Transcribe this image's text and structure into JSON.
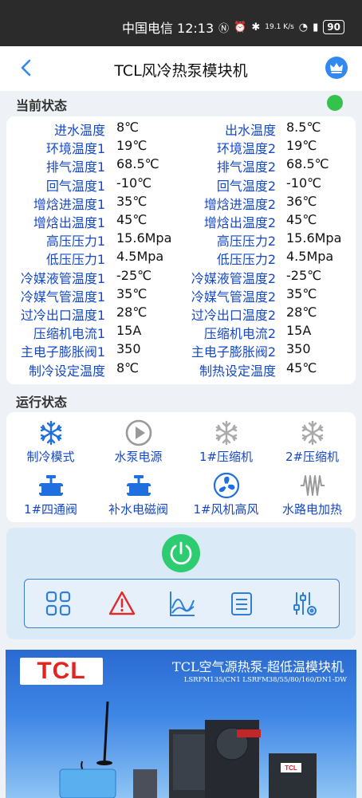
{
  "status_bar": {
    "carrier_time": "中国电信 12:13",
    "net_speed": "19.1 K/s",
    "battery": "90",
    "icons": [
      "nfc-icon",
      "alarm-icon",
      "bluetooth-icon",
      "speed-indicator",
      "signal-icon",
      "wifi-icon",
      "5g-icon",
      "battery-icon"
    ]
  },
  "header": {
    "title": "TCL风冷热泵模块机",
    "back_icon": "back-arrow-icon",
    "vip_icon": "crown-icon"
  },
  "current_status": {
    "title": "当前状态",
    "indicator_color": "#35c24a",
    "rows": [
      {
        "l1": "进水温度",
        "v1": "8℃",
        "l2": "出水温度",
        "v2": "8.5℃"
      },
      {
        "l1": "环境温度1",
        "v1": "19℃",
        "l2": "环境温度2",
        "v2": "19℃"
      },
      {
        "l1": "排气温度1",
        "v1": "68.5℃",
        "l2": "排气温度2",
        "v2": "68.5℃"
      },
      {
        "l1": "回气温度1",
        "v1": "-10℃",
        "l2": "回气温度2",
        "v2": "-10℃"
      },
      {
        "l1": "增焓进温度1",
        "v1": "35℃",
        "l2": "增焓进温度2",
        "v2": "36℃"
      },
      {
        "l1": "增焓出温度1",
        "v1": "45℃",
        "l2": "增焓出温度2",
        "v2": "45℃"
      },
      {
        "l1": "高压压力1",
        "v1": "15.6Mpa",
        "l2": "高压压力2",
        "v2": "15.6Mpa"
      },
      {
        "l1": "低压压力1",
        "v1": "4.5Mpa",
        "l2": "低压压力2",
        "v2": "4.5Mpa"
      },
      {
        "l1": "冷媒液管温度1",
        "v1": "-25℃",
        "l2": "冷媒液管温度2",
        "v2": "-25℃"
      },
      {
        "l1": "冷媒气管温度1",
        "v1": "35℃",
        "l2": "冷媒气管温度2",
        "v2": "35℃"
      },
      {
        "l1": "过冷出口温度1",
        "v1": "28℃",
        "l2": "过冷出口温度2",
        "v2": "28℃"
      },
      {
        "l1": "压缩机电流1",
        "v1": "15A",
        "l2": "压缩机电流2",
        "v2": "15A"
      },
      {
        "l1": "主电子膨胀阀1",
        "v1": "350",
        "l2": "主电子膨胀阀2",
        "v2": "350"
      },
      {
        "l1": "制冷设定温度",
        "v1": "8℃",
        "l2": "制热设定温度",
        "v2": "45℃"
      }
    ]
  },
  "run_status": {
    "title": "运行状态",
    "items": [
      {
        "label": "制冷模式",
        "icon": "snowflake-icon",
        "active": true
      },
      {
        "label": "水泵电源",
        "icon": "play-circle-icon",
        "active": false
      },
      {
        "label": "1#压缩机",
        "icon": "snowflake-icon",
        "active": false
      },
      {
        "label": "2#压缩机",
        "icon": "snowflake-icon",
        "active": false
      },
      {
        "label": "1#四通阀",
        "icon": "valve-icon",
        "active": true
      },
      {
        "label": "补水电磁阀",
        "icon": "valve-icon",
        "active": true
      },
      {
        "label": "1#风机高风",
        "icon": "fan-icon",
        "active": true
      },
      {
        "label": "水路电加热",
        "icon": "heater-icon",
        "active": false
      }
    ]
  },
  "controls": {
    "power_icon": "power-icon",
    "power_color": "#2ecc71",
    "toolbar": [
      "grid-icon",
      "alarm-warning-icon",
      "chart-curve-icon",
      "list-icon",
      "settings-sliders-icon"
    ]
  },
  "banner": {
    "logo": "TCL",
    "title": "TCL空气源热泵-超低温模块机",
    "subtitle": "LSRFM135/CN1  LSRFM38/55/80/160/DN1-DW"
  }
}
